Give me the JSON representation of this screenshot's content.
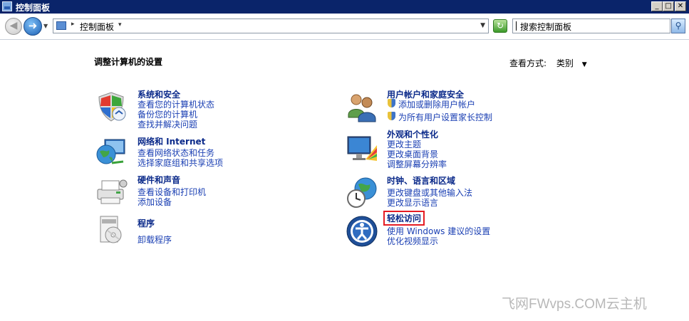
{
  "window": {
    "title": "控制面板"
  },
  "window_buttons": {
    "minimize": "_",
    "maximize": "□",
    "close": "✕"
  },
  "address": {
    "breadcrumb": "控制面板",
    "search_placeholder": "搜索控制面板"
  },
  "main": {
    "heading": "调整计算机的设置",
    "view_by_label": "查看方式:",
    "view_by_value": "类别"
  },
  "categories": [
    {
      "title": "系统和安全",
      "icon": "system-security-shield-icon",
      "links": [
        "查看您的计算机状态",
        "备份您的计算机",
        "查找并解决问题"
      ]
    },
    {
      "title": "网络和 Internet",
      "icon": "network-globe-icon",
      "links": [
        "查看网络状态和任务",
        "选择家庭组和共享选项"
      ]
    },
    {
      "title": "硬件和声音",
      "icon": "printer-hardware-icon",
      "links": [
        "查看设备和打印机",
        "添加设备"
      ]
    },
    {
      "title": "程序",
      "icon": "programs-box-icon",
      "links": [
        "卸载程序"
      ]
    },
    {
      "title": "用户帐户和家庭安全",
      "icon": "users-icon",
      "links": [
        "添加或删除用户帐户",
        "为所有用户设置家长控制"
      ]
    },
    {
      "title": "外观和个性化",
      "icon": "appearance-monitor-icon",
      "links": [
        "更改主题",
        "更改桌面背景",
        "调整屏幕分辨率"
      ]
    },
    {
      "title": "时钟、语言和区域",
      "icon": "clock-globe-icon",
      "links": [
        "更改键盘或其他输入法",
        "更改显示语言"
      ]
    },
    {
      "title": "轻松访问",
      "icon": "ease-of-access-icon",
      "links": [
        "使用 Windows 建议的设置",
        "优化视频显示"
      ]
    }
  ],
  "watermark": "飞网FWvps.COM云主机",
  "colors": {
    "title_bar": "#0a246a",
    "category_title": "#0b2a8a",
    "link": "#1a3fb3",
    "highlight": "#e51c23"
  }
}
